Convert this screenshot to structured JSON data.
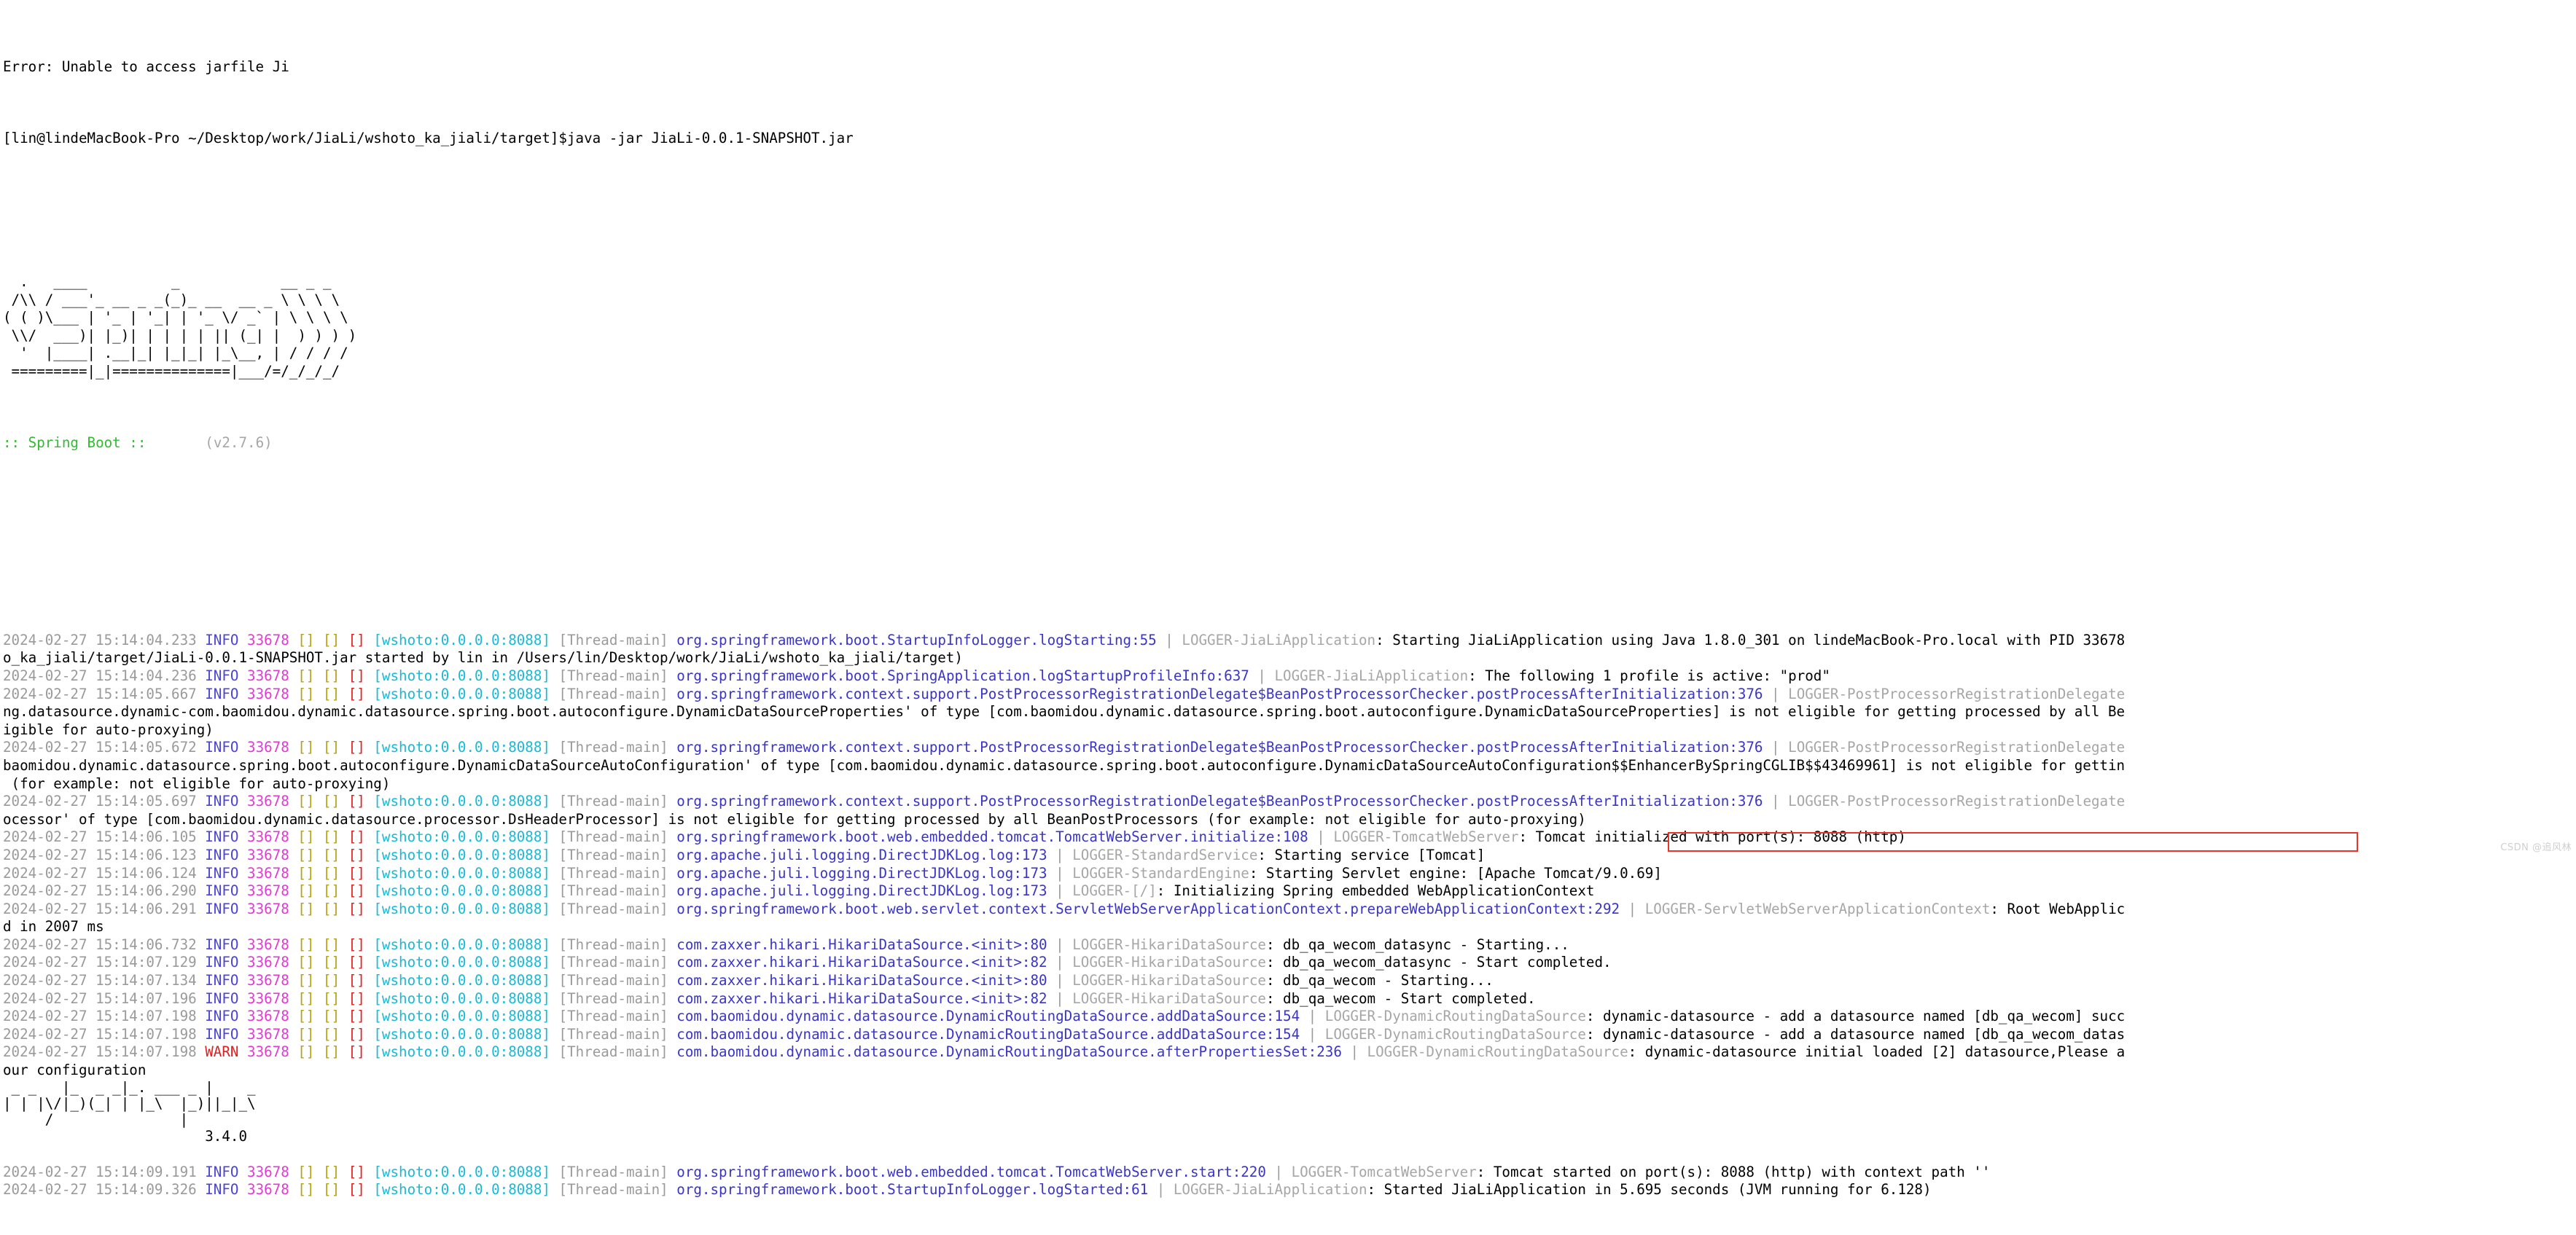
{
  "terminal": {
    "error_line": "Error: Unable to access jarfile Ji",
    "prompt": {
      "full": "[lin@lindeMacBook-Pro ~/Desktop/work/JiaLi/wshoto_ka_jiali/target]$java -jar JiaLi-0.0.1-SNAPSHOT.jar",
      "user": "lin",
      "host": "lindeMacBook-Pro",
      "cwd": "~/Desktop/work/JiaLi/wshoto_ka_jiali/target",
      "command": "java -jar JiaLi-0.0.1-SNAPSHOT.jar"
    },
    "spring_banner": {
      "art": "  .   ____          _            __ _ _\n /\\\\ / ___'_ __ _ _(_)_ __  __ _ \\ \\ \\ \\\n( ( )\\___ | '_ | '_| | '_ \\/ _` | \\ \\ \\ \\\n \\\\/  ___)| |_)| | | | | || (_| |  ) ) ) )\n  '  |____| .__|_| |_|_| |_\\__, | / / / /\n =========|_|==============|___/=/_/_/_/",
      "label": ":: Spring Boot ::",
      "version": "(v2.7.6)"
    },
    "mybatis_banner": {
      "art": " _ _   |_  _ _|_. ___ _ |    _\n| | |\\/|_)(_| | |_\\  |_)||_|_\\\n     /               |",
      "version": "3.4.0"
    },
    "watermark": "CSDN @追风林",
    "log_meta": {
      "date": "2024-02-27",
      "pid": "33678",
      "app_tag": "[wshoto:0.0.0.0:8088]",
      "thread": "[Thread-main]",
      "empty_brackets": [
        "[]",
        "[]",
        "[]"
      ],
      "level_info": "INFO",
      "level_warn": "WARN",
      "separator": "|"
    },
    "colors": {
      "timestamp": "#9a9a9a",
      "info": "#4b45d6",
      "warn": "#e02020",
      "pid": "#e23ad2",
      "bracket_olive": "#b2a21a",
      "bracket_cyan": "#1ab9d4",
      "bracket_red": "#e02020",
      "app_tag": "#1ab9d4",
      "thread": "#9a9a9a",
      "logger_class": "#4b45d6",
      "logger_name": "#a6a6a6",
      "message": "#000000",
      "spring_green": "#33bb33",
      "highlight_box": "#e8342a"
    },
    "highlight": {
      "text": ": Started JiaLiApplication in 5.695 seconds (JVM running for 6.128)",
      "startup_seconds": "5.695",
      "jvm_seconds": "6.128"
    },
    "log_lines": [
      {
        "time": "15:14:04.233",
        "level": "INFO",
        "logger_class": "org.springframework.boot.StartupInfoLogger.logStarting:55",
        "logger_name": "LOGGER-JiaLiApplication",
        "message": ": Starting JiaLiApplication using Java 1.8.0_301 on lindeMacBook-Pro.local with PID 33678",
        "wrap": "o_ka_jiali/target/JiaLi-0.0.1-SNAPSHOT.jar started by lin in /Users/lin/Desktop/work/JiaLi/wshoto_ka_jiali/target)"
      },
      {
        "time": "15:14:04.236",
        "level": "INFO",
        "logger_class": "org.springframework.boot.SpringApplication.logStartupProfileInfo:637",
        "logger_name": "LOGGER-JiaLiApplication",
        "message": ": The following 1 profile is active: \"prod\"",
        "wrap": ""
      },
      {
        "time": "15:14:05.667",
        "level": "INFO",
        "logger_class": "org.springframework.context.support.PostProcessorRegistrationDelegate$BeanPostProcessorChecker.postProcessAfterInitialization:376",
        "logger_name": "LOGGER-PostProcessorRegistrationDelegate",
        "message": "",
        "wrap": "ng.datasource.dynamic-com.baomidou.dynamic.datasource.spring.boot.autoconfigure.DynamicDataSourceProperties' of type [com.baomidou.dynamic.datasource.spring.boot.autoconfigure.DynamicDataSourceProperties] is not eligible for getting processed by all Be\nigible for auto-proxying)"
      },
      {
        "time": "15:14:05.672",
        "level": "INFO",
        "logger_class": "org.springframework.context.support.PostProcessorRegistrationDelegate$BeanPostProcessorChecker.postProcessAfterInitialization:376",
        "logger_name": "LOGGER-PostProcessorRegistrationDelegate",
        "message": "",
        "wrap": "baomidou.dynamic.datasource.spring.boot.autoconfigure.DynamicDataSourceAutoConfiguration' of type [com.baomidou.dynamic.datasource.spring.boot.autoconfigure.DynamicDataSourceAutoConfiguration$$EnhancerBySpringCGLIB$$43469961] is not eligible for gettin\n (for example: not eligible for auto-proxying)"
      },
      {
        "time": "15:14:05.697",
        "level": "INFO",
        "logger_class": "org.springframework.context.support.PostProcessorRegistrationDelegate$BeanPostProcessorChecker.postProcessAfterInitialization:376",
        "logger_name": "LOGGER-PostProcessorRegistrationDelegate",
        "message": "",
        "wrap": "ocessor' of type [com.baomidou.dynamic.datasource.processor.DsHeaderProcessor] is not eligible for getting processed by all BeanPostProcessors (for example: not eligible for auto-proxying)"
      },
      {
        "time": "15:14:06.105",
        "level": "INFO",
        "logger_class": "org.springframework.boot.web.embedded.tomcat.TomcatWebServer.initialize:108",
        "logger_name": "LOGGER-TomcatWebServer",
        "message": ": Tomcat initialized with port(s): 8088 (http)",
        "wrap": ""
      },
      {
        "time": "15:14:06.123",
        "level": "INFO",
        "logger_class": "org.apache.juli.logging.DirectJDKLog.log:173",
        "logger_name": "LOGGER-StandardService",
        "message": ": Starting service [Tomcat]",
        "wrap": ""
      },
      {
        "time": "15:14:06.124",
        "level": "INFO",
        "logger_class": "org.apache.juli.logging.DirectJDKLog.log:173",
        "logger_name": "LOGGER-StandardEngine",
        "message": ": Starting Servlet engine: [Apache Tomcat/9.0.69]",
        "wrap": ""
      },
      {
        "time": "15:14:06.290",
        "level": "INFO",
        "logger_class": "org.apache.juli.logging.DirectJDKLog.log:173",
        "logger_name": "LOGGER-[/]",
        "message": ": Initializing Spring embedded WebApplicationContext",
        "wrap": ""
      },
      {
        "time": "15:14:06.291",
        "level": "INFO",
        "logger_class": "org.springframework.boot.web.servlet.context.ServletWebServerApplicationContext.prepareWebApplicationContext:292",
        "logger_name": "LOGGER-ServletWebServerApplicationContext",
        "message": ": Root WebApplic",
        "wrap": "d in 2007 ms"
      },
      {
        "time": "15:14:06.732",
        "level": "INFO",
        "logger_class": "com.zaxxer.hikari.HikariDataSource.<init>:80",
        "logger_name": "LOGGER-HikariDataSource",
        "message": ": db_qa_wecom_datasync - Starting...",
        "wrap": ""
      },
      {
        "time": "15:14:07.129",
        "level": "INFO",
        "logger_class": "com.zaxxer.hikari.HikariDataSource.<init>:82",
        "logger_name": "LOGGER-HikariDataSource",
        "message": ": db_qa_wecom_datasync - Start completed.",
        "wrap": ""
      },
      {
        "time": "15:14:07.134",
        "level": "INFO",
        "logger_class": "com.zaxxer.hikari.HikariDataSource.<init>:80",
        "logger_name": "LOGGER-HikariDataSource",
        "message": ": db_qa_wecom - Starting...",
        "wrap": ""
      },
      {
        "time": "15:14:07.196",
        "level": "INFO",
        "logger_class": "com.zaxxer.hikari.HikariDataSource.<init>:82",
        "logger_name": "LOGGER-HikariDataSource",
        "message": ": db_qa_wecom - Start completed.",
        "wrap": ""
      },
      {
        "time": "15:14:07.198",
        "level": "INFO",
        "logger_class": "com.baomidou.dynamic.datasource.DynamicRoutingDataSource.addDataSource:154",
        "logger_name": "LOGGER-DynamicRoutingDataSource",
        "message": ": dynamic-datasource - add a datasource named [db_qa_wecom] succ",
        "wrap": ""
      },
      {
        "time": "15:14:07.198",
        "level": "INFO",
        "logger_class": "com.baomidou.dynamic.datasource.DynamicRoutingDataSource.addDataSource:154",
        "logger_name": "LOGGER-DynamicRoutingDataSource",
        "message": ": dynamic-datasource - add a datasource named [db_qa_wecom_datas",
        "wrap": ""
      },
      {
        "time": "15:14:07.198",
        "level": "WARN",
        "logger_class": "com.baomidou.dynamic.datasource.DynamicRoutingDataSource.afterPropertiesSet:236",
        "logger_name": "LOGGER-DynamicRoutingDataSource",
        "message": ": dynamic-datasource initial loaded [2] datasource,Please a",
        "wrap": "our configuration"
      },
      {
        "time": "15:14:09.191",
        "level": "INFO",
        "logger_class": "org.springframework.boot.web.embedded.tomcat.TomcatWebServer.start:220",
        "logger_name": "LOGGER-TomcatWebServer",
        "message": ": Tomcat started on port(s): 8088 (http) with context path ''",
        "wrap": ""
      },
      {
        "time": "15:14:09.326",
        "level": "INFO",
        "logger_class": "org.springframework.boot.StartupInfoLogger.logStarted:61",
        "logger_name": "LOGGER-JiaLiApplication",
        "message": ": Started JiaLiApplication in 5.695 seconds (JVM running for 6.128)",
        "wrap": ""
      }
    ]
  }
}
